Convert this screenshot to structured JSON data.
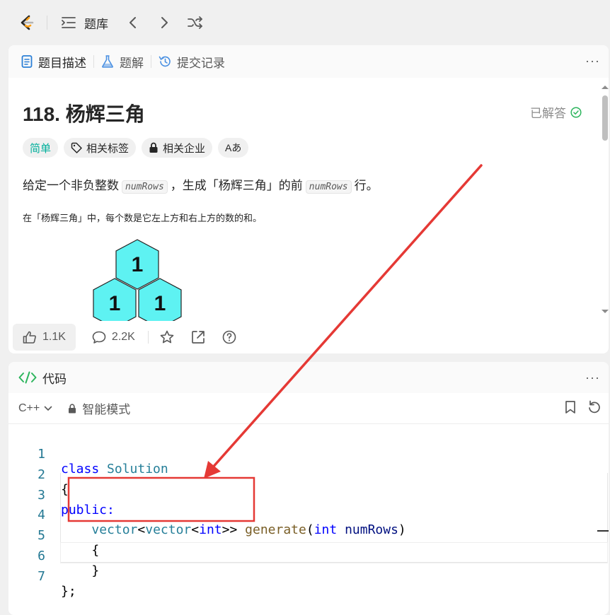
{
  "topbar": {
    "problem_bank_label": "题库"
  },
  "tabs": {
    "description": "题目描述",
    "solutions": "题解",
    "submissions": "提交记录",
    "more": "···"
  },
  "problem": {
    "title": "118. 杨辉三角",
    "status": "已解答",
    "tags": {
      "difficulty": "简单",
      "related_tags": "相关标签",
      "related_companies": "相关企业",
      "translate": "Aあ"
    },
    "desc_part1": "给定一个非负整数",
    "param": "numRows",
    "desc_part2": "，生成「杨辉三角」的前",
    "desc_part3": "行。",
    "desc_sub": "在「杨辉三角」中，每个数是它左上方和右上方的数的和。",
    "triangle": {
      "top": "1",
      "left": "1",
      "right": "1"
    }
  },
  "actions": {
    "likes": "1.1K",
    "comments": "2.2K"
  },
  "code_panel": {
    "title": "代码",
    "more": "···",
    "language": "C++",
    "mode": "智能模式"
  },
  "code_lines": [
    {
      "num": "1"
    },
    {
      "num": "2",
      "text": "{"
    },
    {
      "num": "3"
    },
    {
      "num": "4"
    },
    {
      "num": "5",
      "text": "    {"
    },
    {
      "num": "6",
      "text": "    }"
    },
    {
      "num": "7",
      "text": "};"
    }
  ],
  "code_tokens": {
    "class": "class",
    "solution": "Solution",
    "public": "public:",
    "vector1": "vector",
    "lt1": "<",
    "vector2": "vector",
    "lt2": "<",
    "int1": "int",
    "gtgt": ">>",
    "generate": "generate",
    "paren_open": "(",
    "int2": "int",
    "numrows": "numRows",
    "paren_close": ")"
  },
  "colors": {
    "accent_green": "#00af9b",
    "annotation_red": "#e53935",
    "keyword_blue": "#0000ff",
    "type_teal": "#267f99",
    "function_brown": "#795e26"
  }
}
